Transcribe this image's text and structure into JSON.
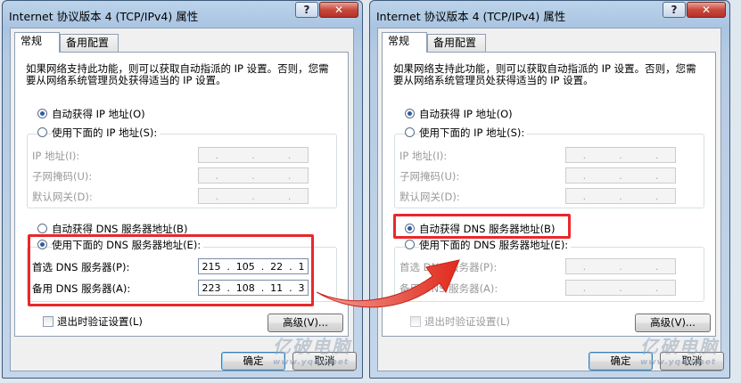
{
  "window_title": "Internet 协议版本 4 (TCP/IPv4) 属性",
  "help_glyph": "?",
  "close_glyph": "✕",
  "tabs": {
    "general": "常规",
    "alternate": "备用配置"
  },
  "description": "如果网络支持此功能，则可以获取自动指派的 IP 设置。否则，您需要从网络系统管理员处获得适当的 IP 设置。",
  "ip": {
    "auto_label": "自动获得 IP 地址(O)",
    "manual_label": "使用下面的 IP 地址(S):",
    "address_label": "IP 地址(I):",
    "mask_label": "子网掩码(U):",
    "gateway_label": "默认网关(D):",
    "dot": "."
  },
  "dns": {
    "auto_label": "自动获得 DNS 服务器地址(B)",
    "manual_label": "使用下面的 DNS 服务器地址(E):",
    "preferred_label": "首选 DNS 服务器(P):",
    "alternate_label": "备用 DNS 服务器(A):",
    "preferred_octets": [
      "215",
      "105",
      "22",
      "1"
    ],
    "alternate_octets": [
      "223",
      "108",
      "11",
      "3"
    ]
  },
  "validate_label": "退出时验证设置(L)",
  "buttons": {
    "advanced": "高级(V)...",
    "ok": "确定",
    "cancel": "取消"
  },
  "watermark": {
    "main": "亿破电脑",
    "sub": "www.yqdn.net"
  },
  "left_dialog": {
    "ip_mode": "auto",
    "dns_mode": "manual"
  },
  "right_dialog": {
    "ip_mode": "auto",
    "dns_mode": "auto"
  },
  "colors": {
    "highlight": "#e8282c",
    "arrow": "#e33a2a",
    "radio_dot": "#2c5ca8"
  }
}
